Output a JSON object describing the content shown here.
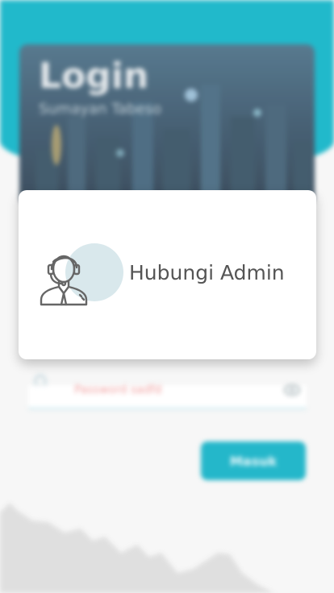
{
  "login_screen": {
    "title": "Login",
    "subtitle": "Sumayan Tabeso",
    "password_placeholder": "Password sadfd",
    "login_button_label": "Masuk"
  },
  "modal": {
    "label": "Hubungi Admin",
    "icon": "customer-support-icon"
  },
  "colors": {
    "accent": "#0FB3C7",
    "button": "#12B1C6",
    "text": "#555555",
    "avatar_bg": "#D9E8EC"
  }
}
